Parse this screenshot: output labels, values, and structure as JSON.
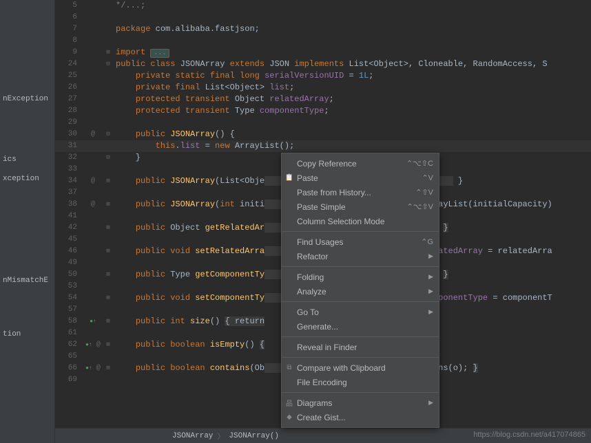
{
  "left_panel": {
    "items": [
      "nException",
      "ics",
      "xception",
      "nMismatchE",
      "tion"
    ]
  },
  "lines": [
    {
      "n": 5,
      "marker": "",
      "fold": "",
      "html": "<span class='comment'>*/...;</span>"
    },
    {
      "n": 6,
      "marker": "",
      "fold": "",
      "html": ""
    },
    {
      "n": 7,
      "marker": "",
      "fold": "",
      "html": "<span class='kw'>package</span> com.alibaba.fastjson;"
    },
    {
      "n": 8,
      "marker": "",
      "fold": "",
      "html": ""
    },
    {
      "n": 9,
      "marker": "",
      "fold": "⊞",
      "html": "<span class='kw'>import</span> <span class='fold-box'>...</span>"
    },
    {
      "n": 24,
      "marker": "",
      "fold": "⊟",
      "html": "<span class='kw'>public class</span> JSONArray <span class='kw'>extends</span> JSON <span class='kw'>implements</span> List&lt;Object&gt;, Cloneable, RandomAccess, S"
    },
    {
      "n": 25,
      "marker": "",
      "fold": "",
      "html": "    <span class='kw'>private static final long</span> <span class='field'>serialVersionUID</span> = <span class='num'>1L</span>;"
    },
    {
      "n": 26,
      "marker": "",
      "fold": "",
      "html": "    <span class='kw'>private final</span> List&lt;Object&gt; <span class='field'>list</span>;"
    },
    {
      "n": 27,
      "marker": "",
      "fold": "",
      "html": "    <span class='kw'>protected transient</span> Object <span class='field'>relatedArray</span>;"
    },
    {
      "n": 28,
      "marker": "",
      "fold": "",
      "html": "    <span class='kw'>protected transient</span> Type <span class='field'>componentType</span>;"
    },
    {
      "n": 29,
      "marker": "",
      "fold": "",
      "html": ""
    },
    {
      "n": 30,
      "marker": "@",
      "fold": "⊟",
      "html": "    <span class='kw'>public</span> <span class='fn'>JSONArray</span>() {"
    },
    {
      "n": 31,
      "marker": "",
      "fold": "",
      "html": "        <span class='kw'>this</span>.<span class='field'>list</span> = <span class='kw'>new</span> ArrayList();",
      "cls": "caret-line"
    },
    {
      "n": 32,
      "marker": "",
      "fold": "⊟",
      "html": "    }"
    },
    {
      "n": 33,
      "marker": "",
      "fold": "",
      "html": ""
    },
    {
      "n": 34,
      "marker": "@",
      "fold": "⊞",
      "html": "    <span class='kw'>public</span> <span class='fn'>JSONArray</span>(List&lt;Obje<span class='bg-folded'>                                      </span> }"
    },
    {
      "n": 37,
      "marker": "",
      "fold": "",
      "html": ""
    },
    {
      "n": 38,
      "marker": "@",
      "fold": "⊞",
      "html": "    <span class='kw'>public</span> <span class='fn'>JSONArray</span>(<span class='kw'>int</span> initi<span class='bg-folded'>                               </span> ArrayList(initialCapacity)"
    },
    {
      "n": 41,
      "marker": "",
      "fold": "",
      "html": ""
    },
    {
      "n": 42,
      "marker": "",
      "fold": "⊞",
      "html": "    <span class='kw'>public</span> Object <span class='fn'>getRelatedAr</span><span class='bg-folded'>                               </span>ray; <span class='bg-folded'>}</span>"
    },
    {
      "n": 45,
      "marker": "",
      "fold": "",
      "html": ""
    },
    {
      "n": 46,
      "marker": "",
      "fold": "⊞",
      "html": "    <span class='kw'>public void</span> <span class='fn'>setRelatedArra</span><span class='bg-folded'>                               </span>.<span class='field'>relatedArray</span> = relatedArra"
    },
    {
      "n": 49,
      "marker": "",
      "fold": "",
      "html": ""
    },
    {
      "n": 50,
      "marker": "",
      "fold": "⊞",
      "html": "    <span class='kw'>public</span> Type <span class='fn'>getComponentTy</span><span class='bg-folded'>                               </span>ype; <span class='bg-folded'>}</span>"
    },
    {
      "n": 53,
      "marker": "",
      "fold": "",
      "html": ""
    },
    {
      "n": 54,
      "marker": "",
      "fold": "⊞",
      "html": "    <span class='kw'>public void</span> <span class='fn'>setComponentTy</span><span class='bg-folded'>                               </span>.<span class='field'>componentType</span> = componentT"
    },
    {
      "n": 57,
      "marker": "",
      "fold": "",
      "html": ""
    },
    {
      "n": 58,
      "marker": "●↑",
      "fold": "⊞",
      "html": "    <span class='kw'>public int</span> <span class='fn'>size</span>() <span class='bg-folded'>{ return</span>"
    },
    {
      "n": 61,
      "marker": "",
      "fold": "",
      "html": ""
    },
    {
      "n": 62,
      "marker": "●↑ @",
      "fold": "⊞",
      "html": "    <span class='kw'>public boolean</span> <span class='fn'>isEmpty</span>() <span class='bg-folded'>{</span>"
    },
    {
      "n": 65,
      "marker": "",
      "fold": "",
      "html": ""
    },
    {
      "n": 66,
      "marker": "●↑ @",
      "fold": "⊞",
      "html": "    <span class='kw'>public boolean</span> <span class='fn'>contains</span>(Ob<span class='bg-folded'>                               </span>ntains(o); <span class='bg-folded'>}</span>"
    },
    {
      "n": 69,
      "marker": "",
      "fold": "",
      "html": ""
    }
  ],
  "breadcrumb": {
    "path": [
      "JSONArray",
      "JSONArray()"
    ]
  },
  "context_menu": {
    "groups": [
      [
        {
          "label": "Copy Reference",
          "shortcut": "⌃⌥⇧C"
        },
        {
          "label": "Paste",
          "shortcut": "⌃V",
          "icon": "📋"
        },
        {
          "label": "Paste from History...",
          "shortcut": "⌃⇧V"
        },
        {
          "label": "Paste Simple",
          "shortcut": "⌃⌥⇧V"
        },
        {
          "label": "Column Selection Mode",
          "shortcut": ""
        }
      ],
      [
        {
          "label": "Find Usages",
          "shortcut": "⌃G"
        },
        {
          "label": "Refactor",
          "submenu": true
        }
      ],
      [
        {
          "label": "Folding",
          "submenu": true
        },
        {
          "label": "Analyze",
          "submenu": true
        }
      ],
      [
        {
          "label": "Go To",
          "submenu": true
        },
        {
          "label": "Generate...",
          "shortcut": ""
        }
      ],
      [
        {
          "label": "Reveal in Finder"
        }
      ],
      [
        {
          "label": "Compare with Clipboard",
          "icon": "⧉"
        },
        {
          "label": "File Encoding"
        }
      ],
      [
        {
          "label": "Diagrams",
          "submenu": true,
          "icon": "品"
        },
        {
          "label": "Create Gist...",
          "icon": "◆"
        }
      ]
    ]
  },
  "watermark": "https://blog.csdn.net/a417074865"
}
